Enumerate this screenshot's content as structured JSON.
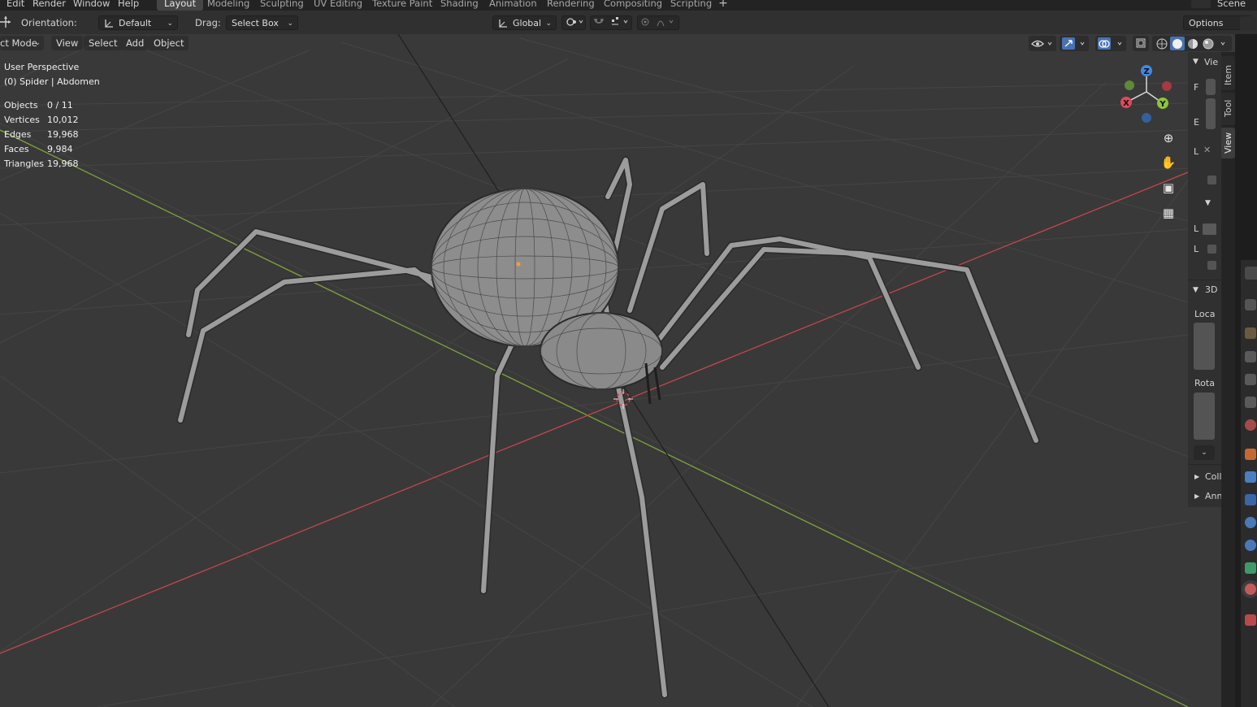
{
  "topbar": {
    "menus": [
      "Edit",
      "Render",
      "Window",
      "Help"
    ],
    "workspaces": [
      "Layout",
      "Modeling",
      "Sculpting",
      "UV Editing",
      "Texture Paint",
      "Shading",
      "Animation",
      "Rendering",
      "Compositing",
      "Scripting"
    ],
    "active_workspace": "Layout",
    "add_workspace": "+",
    "scene": "Scene"
  },
  "tool_header": {
    "orientation_label": "Orientation:",
    "orientation_value": "Default",
    "drag_label": "Drag:",
    "drag_value": "Select Box",
    "transform_orientation": "Global",
    "options_label": "Options"
  },
  "viewport_header": {
    "mode": "ct Mode",
    "menus": [
      "View",
      "Select",
      "Add",
      "Object"
    ]
  },
  "overlay": {
    "perspective": "User Perspective",
    "object_info": "(0) Spider | Abdomen",
    "stats": [
      {
        "key": "Objects",
        "value": "0 / 11"
      },
      {
        "key": "Vertices",
        "value": "10,012"
      },
      {
        "key": "Edges",
        "value": "19,968"
      },
      {
        "key": "Faces",
        "value": "9,984"
      },
      {
        "key": "Triangles",
        "value": "19,968"
      }
    ]
  },
  "gizmo": {
    "z": "Z",
    "y": "Y",
    "x": "X"
  },
  "sidebar": {
    "view_header": "Vie",
    "f_label": "F",
    "e_label": "E",
    "l1": "L",
    "l2": "L",
    "l3": "L",
    "section_3d": "3D",
    "location_label": "Loca",
    "rotation_label": "Rota",
    "collections": "Coll",
    "annotations": "Ann",
    "tabs": [
      "Item",
      "Tool",
      "View"
    ],
    "active_tab": "View"
  },
  "colors": {
    "x_axis": "#c2464e",
    "y_axis": "#7ea53a",
    "z_gizmo": "#3f8ae0",
    "accent": "#4772b3"
  }
}
